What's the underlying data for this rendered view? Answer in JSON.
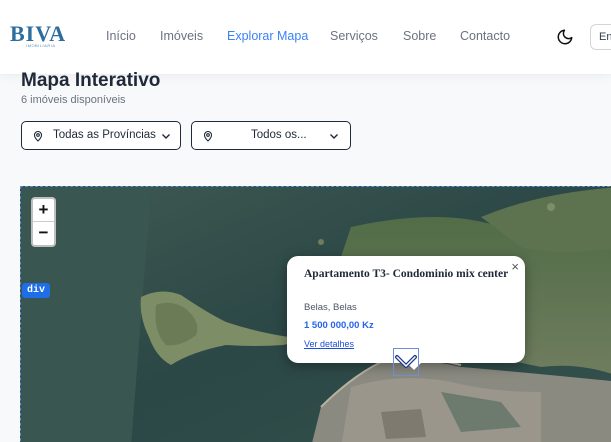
{
  "header": {
    "logo_text": "BIVA",
    "logo_sub": "IMOBILIARIA",
    "nav": [
      {
        "label": "Início",
        "active": false
      },
      {
        "label": "Imóveis",
        "active": false
      },
      {
        "label": "Explorar Mapa",
        "active": true
      },
      {
        "label": "Serviços",
        "active": false
      },
      {
        "label": "Sobre",
        "active": false
      },
      {
        "label": "Contacto",
        "active": false
      }
    ],
    "lang_label": "En"
  },
  "page": {
    "title": "Mapa Interativo",
    "subtitle": "6 imóveis disponíveis"
  },
  "filters": {
    "province": "Todas as Províncias",
    "municipality": "Todos os..."
  },
  "map": {
    "zoom_in": "+",
    "zoom_out": "−",
    "debug_tag": "div",
    "popup": {
      "title": "Apartamento T3- Condominio mix center",
      "location": "Belas, Belas",
      "price": "1 500 000,00 Kz",
      "link": "Ver detalhes",
      "close": "×"
    }
  },
  "colors": {
    "accent": "#3b82f6",
    "price": "#2563eb",
    "logo": "#2d6e9e"
  }
}
